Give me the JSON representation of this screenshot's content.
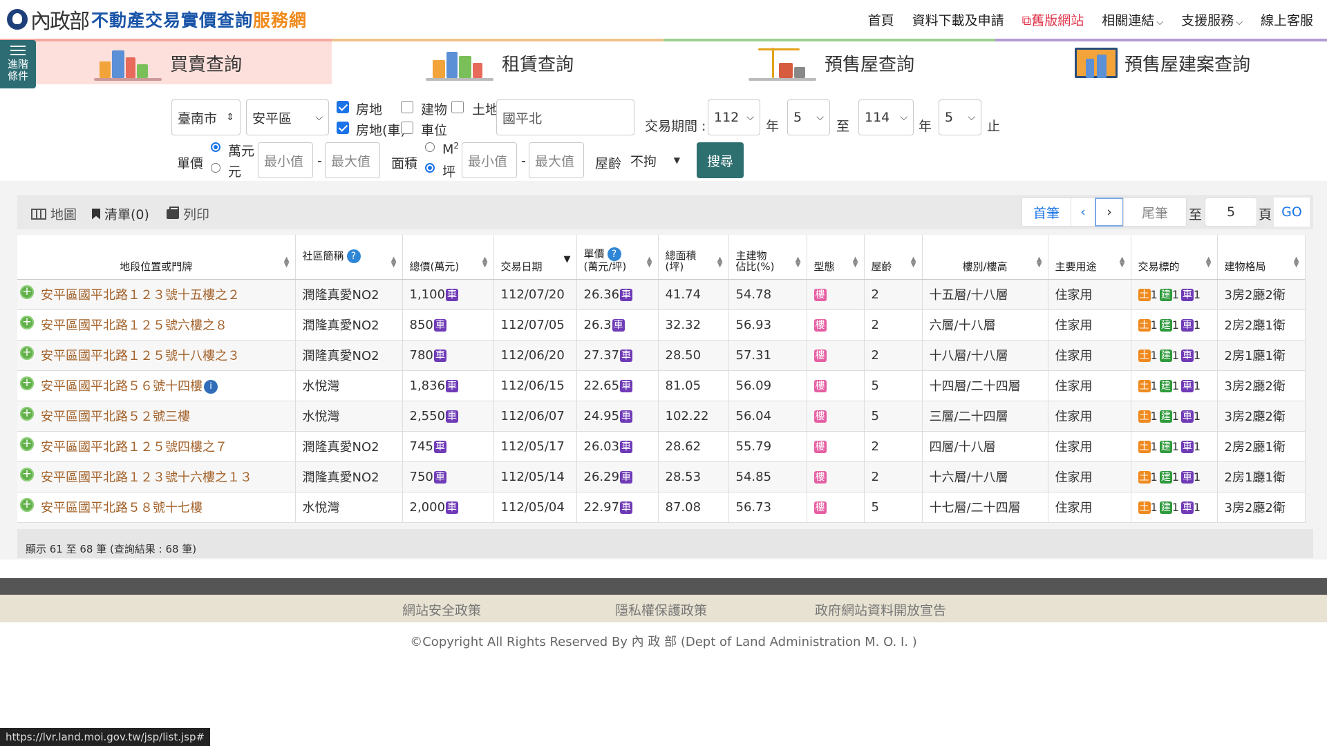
{
  "header": {
    "logo_moi": "內政部",
    "title_main": "不動產交易實價查詢",
    "title_service": "服務網",
    "nav": {
      "home": "首頁",
      "download": "資料下載及申請",
      "old_site": "舊版網站",
      "related": "相關連結",
      "support": "支援服務",
      "service": "線上客服"
    }
  },
  "tabs": {
    "buy_sell": "買賣查詢",
    "rent": "租賃查詢",
    "presale": "預售屋查詢",
    "presale_project": "預售屋建案查詢"
  },
  "advanced": "進階條件",
  "filters": {
    "city": "臺南市",
    "district": "安平區",
    "cb_real_estate": "房地",
    "cb_building": "建物",
    "cb_land": "土地",
    "cb_real_estate_car": "房地(車)",
    "cb_parking": "車位",
    "keyword": "國平北",
    "period_label": "交易期間 :",
    "from_year": "112",
    "year_label": "年",
    "from_month": "5",
    "to_label": "至",
    "to_year": "114",
    "to_month": "5",
    "end_label": "止",
    "unit_price_label": "單價",
    "unit_wan": "萬元",
    "unit_yuan": "元",
    "min_placeholder": "最小值",
    "max_placeholder": "最大值",
    "dash": "-",
    "area_label": "面積",
    "area_m2": "M",
    "area_m2_sup": "2",
    "area_ping": "坪",
    "age_label": "屋齡",
    "age_value": "不拘",
    "search": "搜尋"
  },
  "toolbar": {
    "map": "地圖",
    "list": "清單(0)",
    "print": "列印",
    "first": "首筆",
    "prev": "‹",
    "next": "›",
    "last": "尾筆",
    "goto": "至",
    "page_value": "5",
    "page": "頁",
    "go": "GO"
  },
  "table": {
    "headers": {
      "address": "地段位置或門牌",
      "community": "社區簡稱",
      "total": "總價(萬元)",
      "date": "交易日期",
      "unit_price_1": "單價",
      "unit_price_2": "(萬元/坪)",
      "area_1": "總面積",
      "area_2": "(坪)",
      "main_bld_1": "主建物",
      "main_bld_2": "佔比(%)",
      "type": "型態",
      "age": "屋齡",
      "floor": "樓別/樓高",
      "usage": "主要用途",
      "target": "交易標的",
      "layout": "建物格局"
    },
    "help_glyph": "?",
    "car_badge": "車",
    "type_badge": "樓",
    "target_land": "土",
    "target_bld": "建",
    "target_car": "車",
    "target_count": "1",
    "rows": [
      {
        "address": "安平區國平北路１２３號十五樓之２",
        "community": "潤隆真愛NO2",
        "total": "1,100",
        "date": "112/07/20",
        "unit": "26.36",
        "area": "41.74",
        "ratio": "54.78",
        "age": "2",
        "floor": "十五層/十八層",
        "usage": "住家用",
        "layout": "3房2廳2衛"
      },
      {
        "address": "安平區國平北路１２５號六樓之８",
        "community": "潤隆真愛NO2",
        "total": "850",
        "date": "112/07/05",
        "unit": "26.3",
        "area": "32.32",
        "ratio": "56.93",
        "age": "2",
        "floor": "六層/十八層",
        "usage": "住家用",
        "layout": "2房2廳1衛"
      },
      {
        "address": "安平區國平北路１２５號十八樓之３",
        "community": "潤隆真愛NO2",
        "total": "780",
        "date": "112/06/20",
        "unit": "27.37",
        "area": "28.50",
        "ratio": "57.31",
        "age": "2",
        "floor": "十八層/十八層",
        "usage": "住家用",
        "layout": "2房1廳1衛"
      },
      {
        "address": "安平區國平北路５６號十四樓",
        "community": "水悅灣",
        "total": "1,836",
        "date": "112/06/15",
        "unit": "22.65",
        "area": "81.05",
        "ratio": "56.09",
        "age": "5",
        "floor": "十四層/二十四層",
        "usage": "住家用",
        "layout": "3房2廳2衛"
      },
      {
        "address": "安平區國平北路５２號三樓",
        "community": "水悅灣",
        "total": "2,550",
        "date": "112/06/07",
        "unit": "24.95",
        "area": "102.22",
        "ratio": "56.04",
        "age": "5",
        "floor": "三層/二十四層",
        "usage": "住家用",
        "layout": "3房2廳2衛"
      },
      {
        "address": "安平區國平北路１２５號四樓之７",
        "community": "潤隆真愛NO2",
        "total": "745",
        "date": "112/05/17",
        "unit": "26.03",
        "area": "28.62",
        "ratio": "55.79",
        "age": "2",
        "floor": "四層/十八層",
        "usage": "住家用",
        "layout": "2房2廳1衛"
      },
      {
        "address": "安平區國平北路１２３號十六樓之１３",
        "community": "潤隆真愛NO2",
        "total": "750",
        "date": "112/05/14",
        "unit": "26.29",
        "area": "28.53",
        "ratio": "54.85",
        "age": "2",
        "floor": "十六層/十八層",
        "usage": "住家用",
        "layout": "2房1廳1衛"
      },
      {
        "address": "安平區國平北路５８號十七樓",
        "community": "水悅灣",
        "total": "2,000",
        "date": "112/05/04",
        "unit": "22.97",
        "area": "87.08",
        "ratio": "56.73",
        "age": "5",
        "floor": "十七層/二十四層",
        "usage": "住家用",
        "layout": "3房2廳2衛"
      }
    ]
  },
  "summary": "顯示 61 至 68 筆 (查詢結果 : 68 筆)",
  "footer": {
    "security": "網站安全政策",
    "privacy": "隱私權保護政策",
    "open_data": "政府網站資料開放宣告",
    "copyright": "©Copyright All Rights Reserved By 內 政 部 (Dept of Land Administration M. O. I. )"
  },
  "status_url": "https://lvr.land.moi.gov.tw/jsp/list.jsp#",
  "colors": {
    "brand_blue": "#1a55a8",
    "brand_orange": "#f08a1c",
    "search_button": "#2e6f6f",
    "address_link": "#a3622a",
    "old_site_red": "#e0334a"
  },
  "icons": [
    "moi-logo-icon",
    "sliders-icon",
    "external-link-icon",
    "chevron-down-icon",
    "map-icon",
    "bookmark-icon",
    "print-icon",
    "sort-icon",
    "help-icon",
    "expand-plus-icon",
    "info-icon"
  ]
}
